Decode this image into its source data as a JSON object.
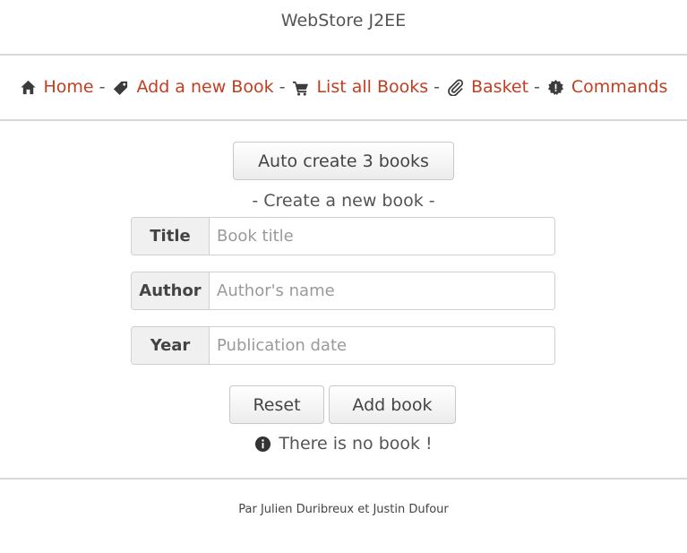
{
  "header": {
    "title": "WebStore J2EE"
  },
  "nav": {
    "separator": "-",
    "items": [
      {
        "label": "Home",
        "icon": "home-icon"
      },
      {
        "label": "Add a new Book",
        "icon": "tag-icon"
      },
      {
        "label": "List all Books",
        "icon": "cart-icon"
      },
      {
        "label": "Basket",
        "icon": "paperclip-icon"
      },
      {
        "label": "Commands",
        "icon": "certificate-icon"
      }
    ]
  },
  "main": {
    "auto_create_label": "Auto create 3 books",
    "form_title": "- Create a new book -",
    "fields": [
      {
        "label": "Title",
        "value": "",
        "placeholder": "Book title"
      },
      {
        "label": "Author",
        "value": "",
        "placeholder": "Author's name"
      },
      {
        "label": "Year",
        "value": "",
        "placeholder": "Publication date"
      }
    ],
    "reset_label": "Reset",
    "add_label": "Add book",
    "notice": {
      "icon": "info-circle-icon",
      "text": "There is no book !"
    }
  },
  "footer": {
    "credits": "Par Julien Duribreux et Justin Dufour"
  },
  "colors": {
    "link": "#c33d20",
    "text": "#444444",
    "divider": "#d9d9d9",
    "icon": "#3b3b3b"
  }
}
